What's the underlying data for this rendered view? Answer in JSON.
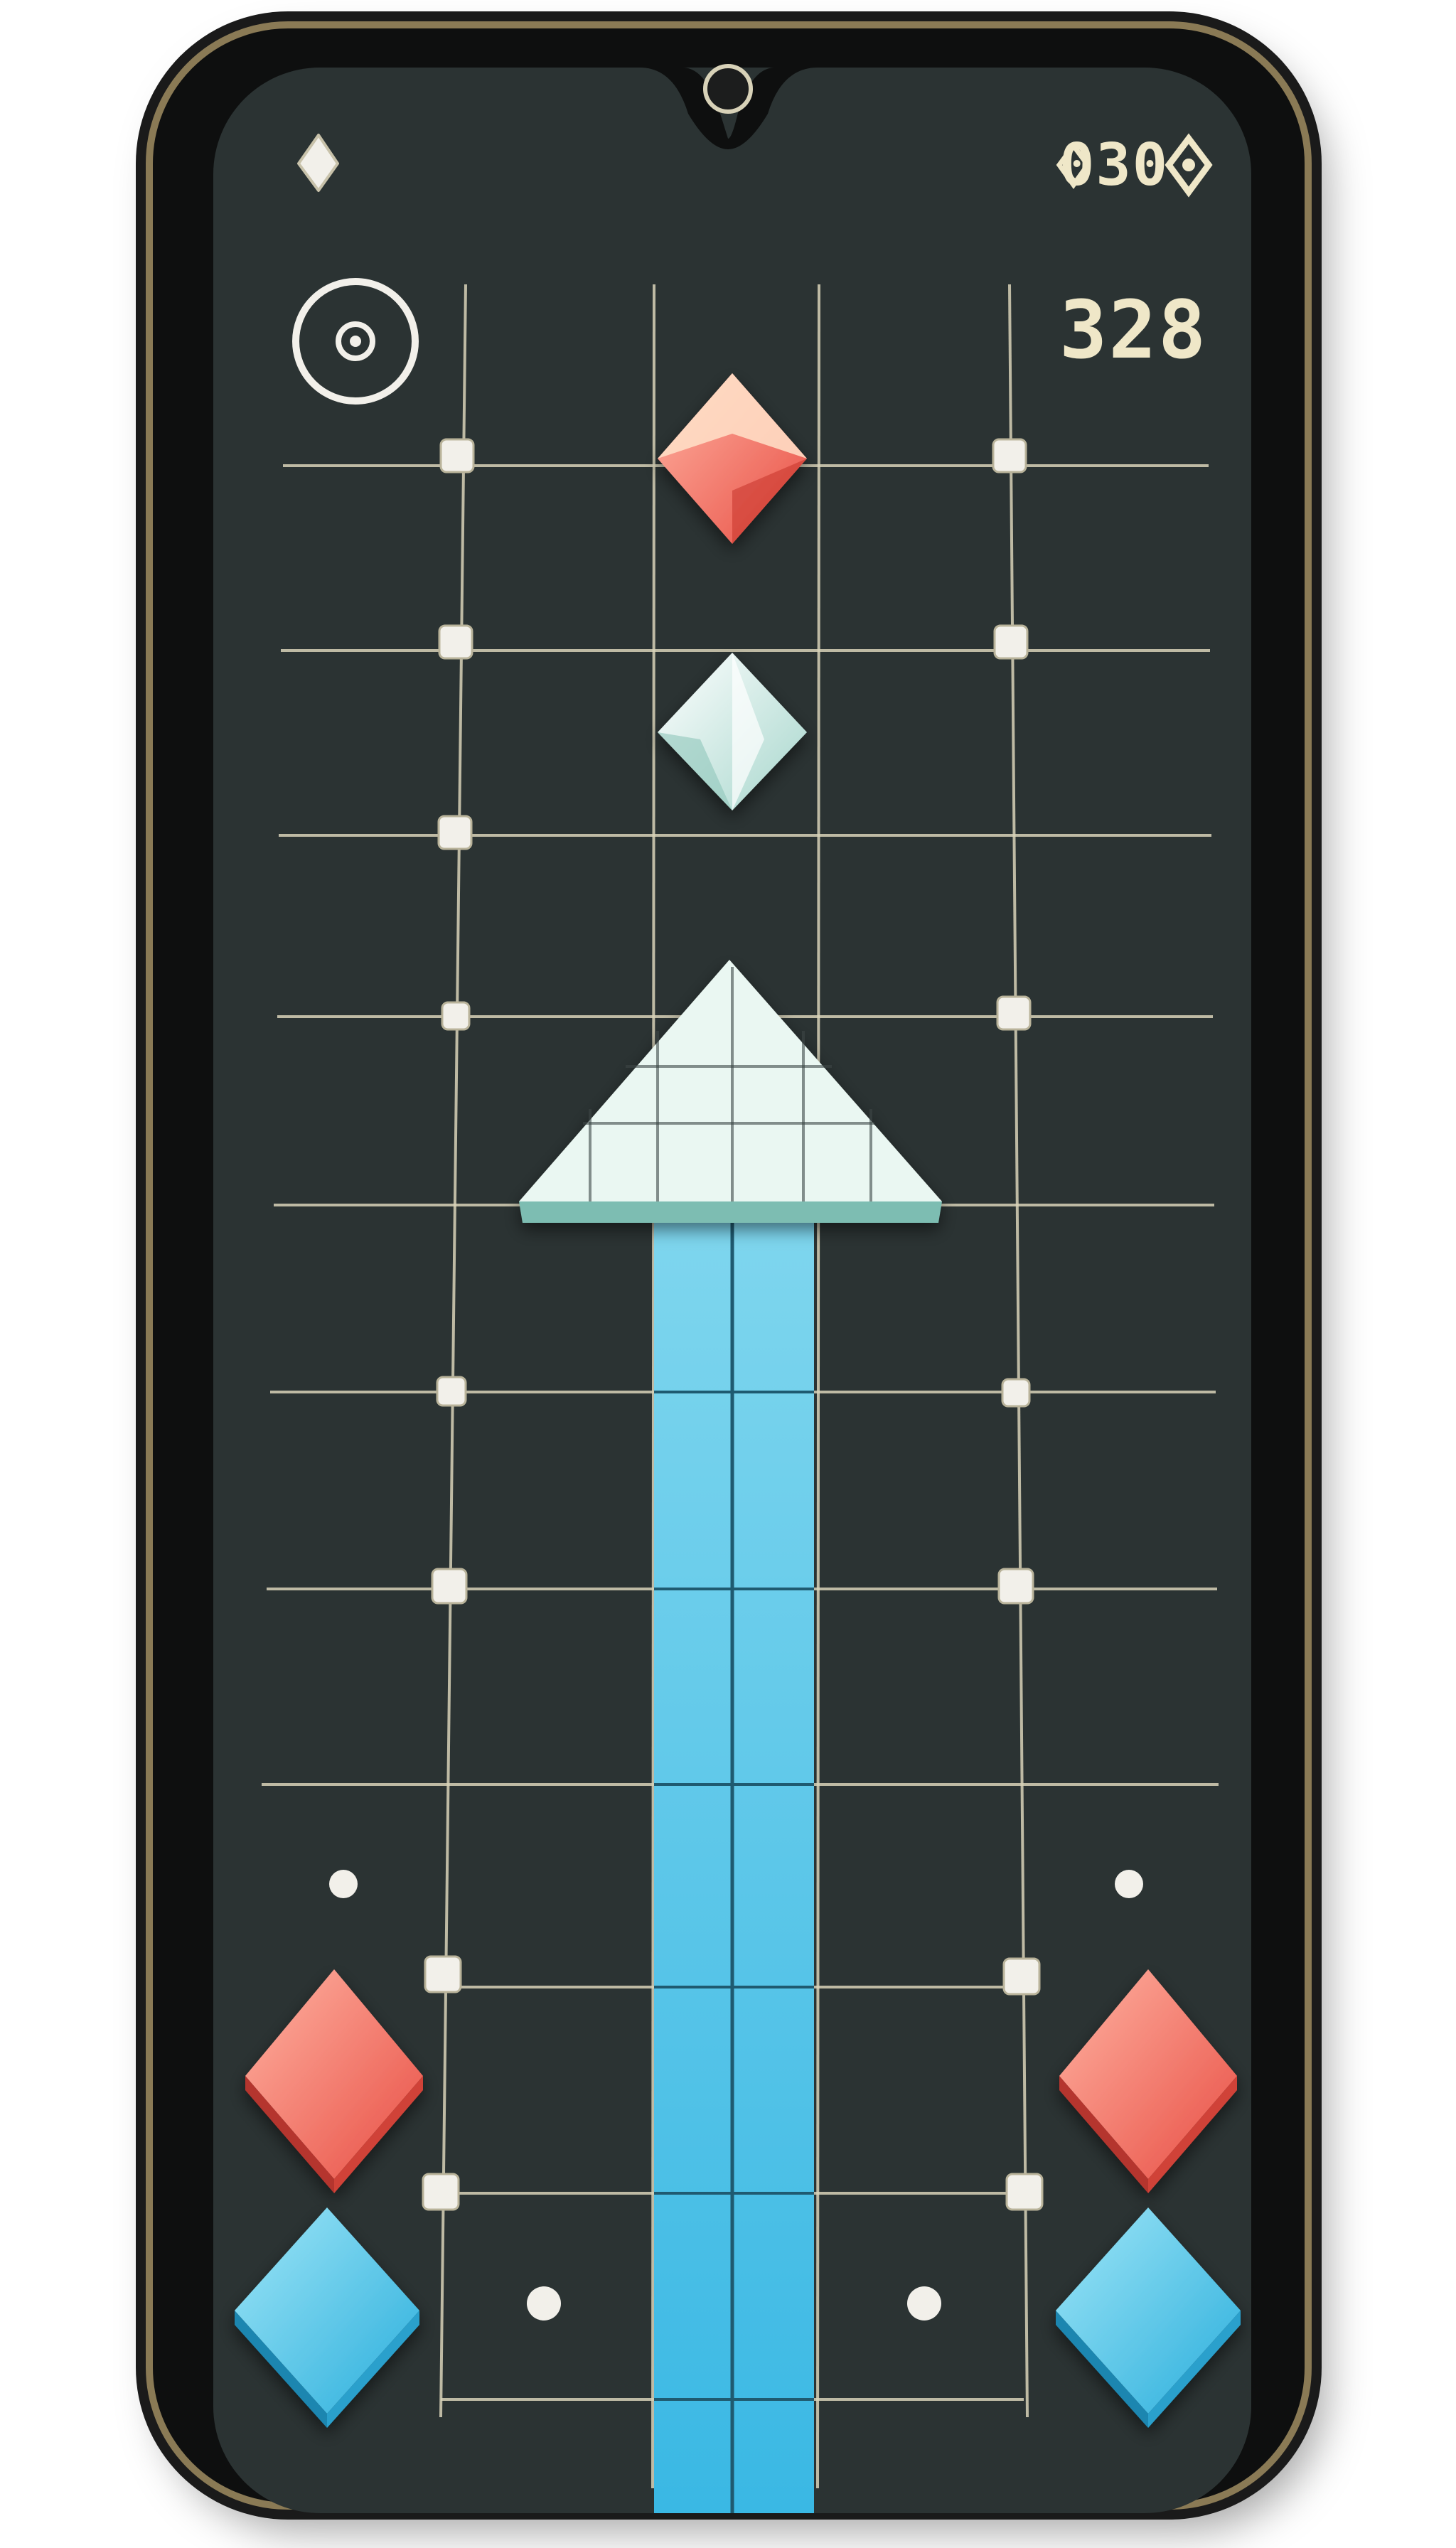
{
  "hud": {
    "moves_text": "030",
    "score_text": "328"
  },
  "colors": {
    "screen_bg": "#2b3333",
    "grid_line": "#d8d2b8",
    "node": "#f2f0ea",
    "arrow_head": "#eaf7f2",
    "arrow_shaft": "#4dc3e6",
    "red_gem": "#f0685a",
    "blue_gem": "#4cc8e8",
    "white_gem": "#d6ece6",
    "hud_text": "#efe7c8"
  },
  "icons": {
    "top_left": "diamond-icon",
    "top_right_suffix": "diamond-icon",
    "target_button": "target-icon"
  },
  "pieces": [
    {
      "name": "red-gem-top",
      "color": "red"
    },
    {
      "name": "white-gem",
      "color": "white"
    },
    {
      "name": "red-gem-left",
      "color": "red"
    },
    {
      "name": "red-gem-right",
      "color": "red"
    },
    {
      "name": "blue-gem-left",
      "color": "blue"
    },
    {
      "name": "blue-gem-right",
      "color": "blue"
    }
  ],
  "player_arrow": {
    "direction": "up",
    "color": "cyan"
  }
}
